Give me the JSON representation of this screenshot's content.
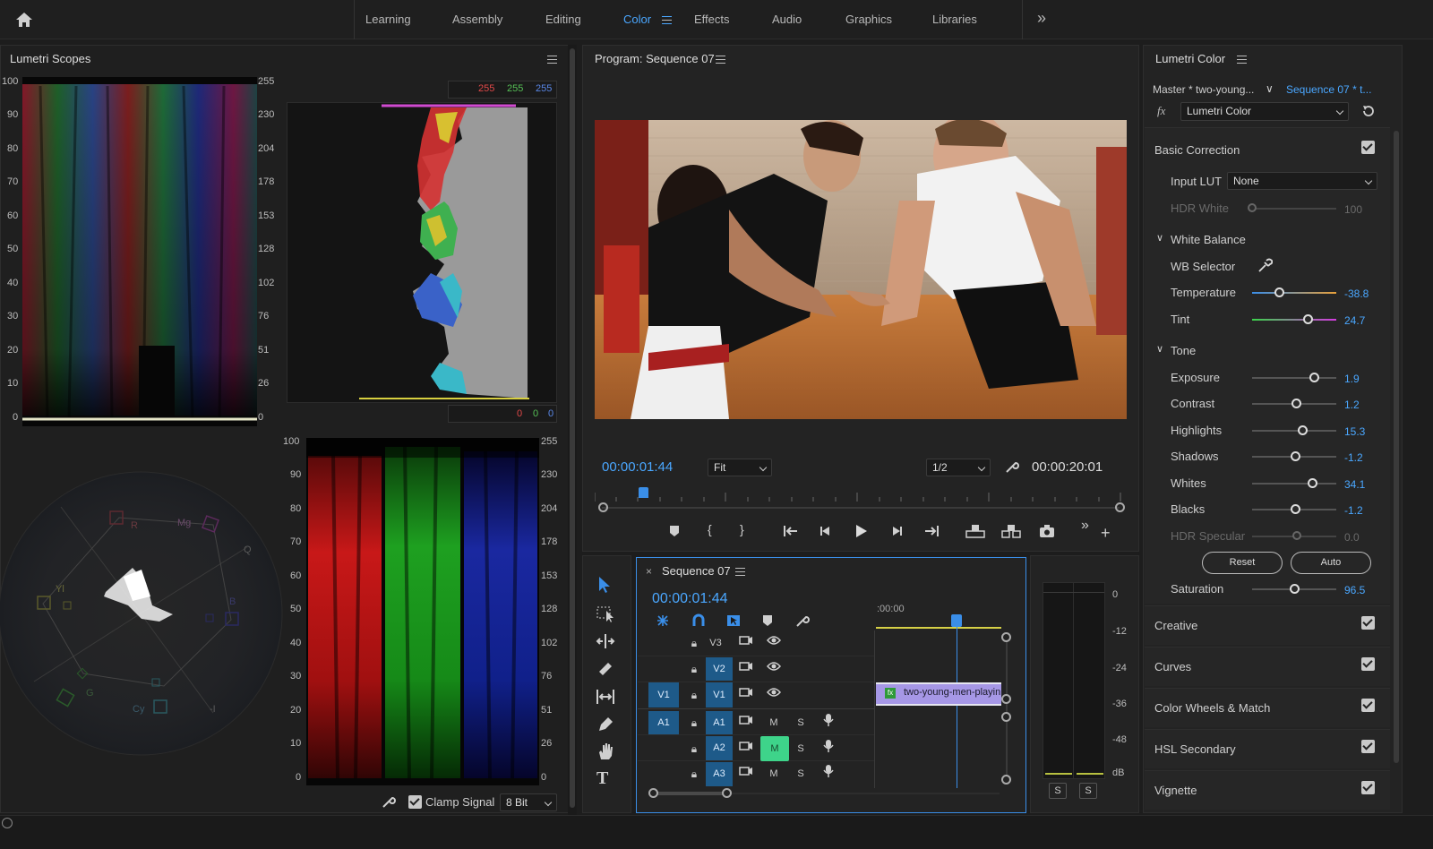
{
  "workspaces": {
    "tabs": [
      "Learning",
      "Assembly",
      "Editing",
      "Color",
      "Effects",
      "Audio",
      "Graphics",
      "Libraries"
    ],
    "active": "Color",
    "more": "»"
  },
  "scopes": {
    "title": "Lumetri Scopes",
    "waveform_left_ticks": [
      "100",
      "90",
      "80",
      "70",
      "60",
      "50",
      "40",
      "30",
      "20",
      "10",
      "0"
    ],
    "waveform_right_ticks": [
      "255",
      "230",
      "204",
      "178",
      "153",
      "128",
      "102",
      "76",
      "51",
      "26",
      "0"
    ],
    "histogram": {
      "top_r": "255",
      "top_g": "255",
      "top_b": "255",
      "bot_r": "0",
      "bot_g": "0",
      "bot_b": "0"
    },
    "vectorscope_labels": {
      "r": "R",
      "mg": "Mg",
      "b": "B",
      "cy": "Cy",
      "g": "G",
      "yl": "Yl",
      "q": "Q",
      "i": "-I"
    },
    "parade_left_ticks": [
      "100",
      "90",
      "80",
      "70",
      "60",
      "50",
      "40",
      "30",
      "20",
      "10",
      "0"
    ],
    "parade_right_ticks": [
      "255",
      "230",
      "204",
      "178",
      "153",
      "128",
      "102",
      "76",
      "51",
      "26",
      "0"
    ],
    "clamp_label": "Clamp Signal",
    "bit_depth": "8 Bit"
  },
  "program": {
    "title": "Program: Sequence 07",
    "timecode": "00:00:01:44",
    "fit": "Fit",
    "resolution": "1/2",
    "duration": "00:00:20:01"
  },
  "timeline": {
    "title": "Sequence 07",
    "timecode": "00:00:01:44",
    "ruler_start": ":00:00",
    "clip_name": "two-young-men-playin",
    "video_tracks": [
      {
        "src": "",
        "name": "V3"
      },
      {
        "src": "",
        "name": "V2"
      },
      {
        "src": "V1",
        "name": "V1"
      }
    ],
    "audio_tracks": [
      {
        "src": "A1",
        "name": "A1"
      },
      {
        "src": "",
        "name": "A2"
      },
      {
        "src": "",
        "name": "A3"
      }
    ],
    "m": "M",
    "s": "S"
  },
  "meter": {
    "ticks": [
      "0",
      "-12",
      "-24",
      "-36",
      "-48",
      "dB"
    ],
    "solo_left": "S",
    "solo_right": "S"
  },
  "lumetri": {
    "title": "Lumetri Color",
    "master": "Master * two-young...",
    "sequence": "Sequence 07 * t...",
    "fx": "fx",
    "effect": "Lumetri Color",
    "basic": "Basic Correction",
    "input_lut_label": "Input LUT",
    "input_lut": "None",
    "hdr_white_label": "HDR White",
    "hdr_white": "100",
    "wb": "White Balance",
    "wb_selector": "WB Selector",
    "temperature_label": "Temperature",
    "temperature": "-38.8",
    "tint_label": "Tint",
    "tint": "24.7",
    "tone": "Tone",
    "exposure_label": "Exposure",
    "exposure": "1.9",
    "contrast_label": "Contrast",
    "contrast": "1.2",
    "highlights_label": "Highlights",
    "highlights": "15.3",
    "shadows_label": "Shadows",
    "shadows": "-1.2",
    "whites_label": "Whites",
    "whites": "34.1",
    "blacks_label": "Blacks",
    "blacks": "-1.2",
    "hdr_spec_label": "HDR Specular",
    "hdr_spec": "0.0",
    "reset": "Reset",
    "auto": "Auto",
    "saturation_label": "Saturation",
    "saturation": "96.5",
    "sections": [
      "Creative",
      "Curves",
      "Color Wheels & Match",
      "HSL Secondary",
      "Vignette"
    ]
  }
}
